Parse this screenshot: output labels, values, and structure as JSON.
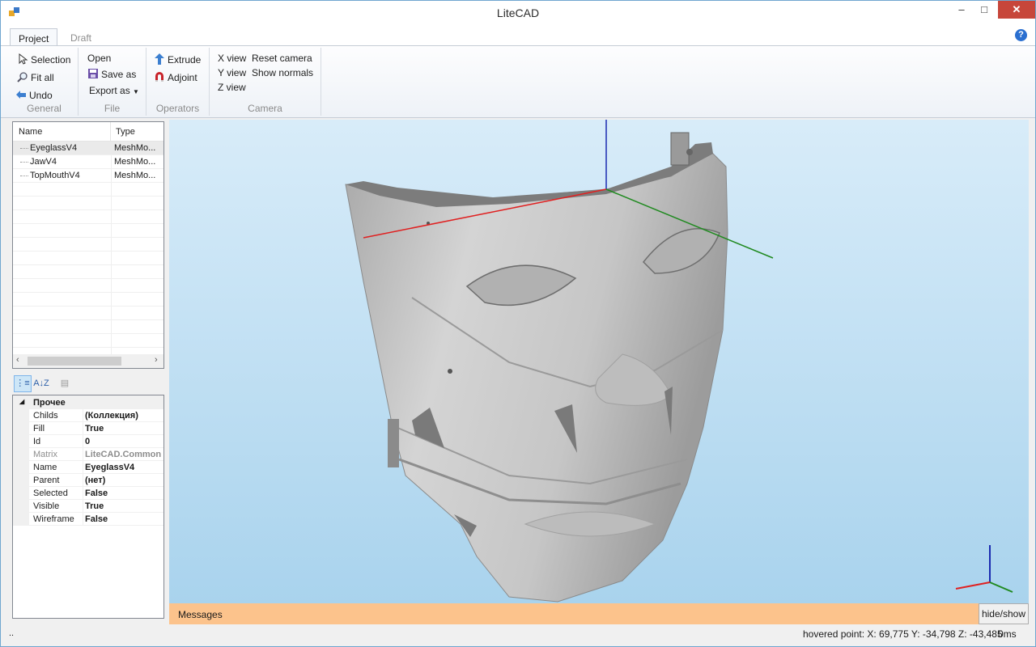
{
  "window": {
    "title": "LiteCAD",
    "minimize": "–",
    "maximize": "□",
    "close": "✕"
  },
  "ribbon": {
    "tabs": [
      {
        "label": "Project",
        "active": true
      },
      {
        "label": "Draft",
        "active": false
      }
    ],
    "help": "?",
    "groups": {
      "general": {
        "label": "General",
        "buttons": [
          "Selection",
          "Fit all",
          "Undo"
        ]
      },
      "file": {
        "label": "File",
        "buttons": [
          "Open",
          "Save as",
          "Export as"
        ]
      },
      "operators": {
        "label": "Operators",
        "buttons": [
          "Extrude",
          "Adjoint"
        ]
      },
      "camera": {
        "label": "Camera",
        "buttons": [
          "X view",
          "Y view",
          "Z view",
          "Reset camera",
          "Show normals"
        ]
      }
    }
  },
  "tree": {
    "headers": {
      "name": "Name",
      "type": "Type"
    },
    "rows": [
      {
        "name": "EyeglassV4",
        "type": "MeshMo...",
        "selected": true
      },
      {
        "name": "JawV4",
        "type": "MeshMo...",
        "selected": false
      },
      {
        "name": "TopMouthV4",
        "type": "MeshMo...",
        "selected": false
      }
    ]
  },
  "properties": {
    "toolbar": {
      "categorized": "⋮≡",
      "alphabetical": "A↓Z",
      "pages": "▤"
    },
    "category": "Прочее",
    "rows": [
      {
        "key": "Childs",
        "value": "(Коллекция)",
        "readonly": false
      },
      {
        "key": "Fill",
        "value": "True",
        "readonly": false
      },
      {
        "key": "Id",
        "value": "0",
        "readonly": false
      },
      {
        "key": "Matrix",
        "value": "LiteCAD.Common",
        "readonly": true
      },
      {
        "key": "Name",
        "value": "EyeglassV4",
        "readonly": false
      },
      {
        "key": "Parent",
        "value": "(нет)",
        "readonly": false
      },
      {
        "key": "Selected",
        "value": "False",
        "readonly": false
      },
      {
        "key": "Visible",
        "value": "True",
        "readonly": false
      },
      {
        "key": "Wireframe",
        "value": "False",
        "readonly": false
      }
    ]
  },
  "messages": {
    "label": "Messages",
    "toggle": "hide/show"
  },
  "status": {
    "left": "..",
    "hovered": "hovered point: X: 69,775 Y: -34,798 Z: -43,485",
    "time": "0ms"
  },
  "colors": {
    "axis_x": "#e02020",
    "axis_y": "#208a20",
    "axis_z": "#1a2ab0",
    "mesh": "#c9c9c9",
    "messages_bar": "#fcc38c",
    "viewport_top": "#d8ecf9",
    "viewport_bottom": "#a9d3ed"
  }
}
